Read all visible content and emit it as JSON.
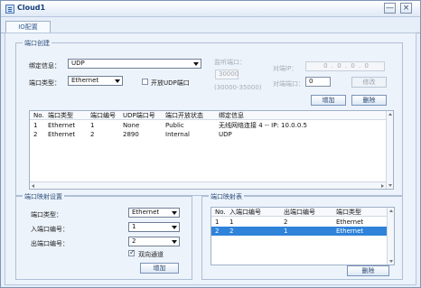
{
  "window": {
    "title": "Cloud1",
    "controls": {
      "minimize": "—",
      "close": "×"
    }
  },
  "tabs": [
    {
      "label": "IO配置",
      "selected": true
    }
  ],
  "port_creation": {
    "title": "端口创建",
    "binding_info_label": "绑定信息：",
    "binding_info_value": "UDP",
    "port_type_label": "端口类型：",
    "port_type_value": "Ethernet",
    "open_udp_label": "开放UDP端口",
    "open_udp_checked": false,
    "listen_port_label": "监听端口：",
    "listen_port_value": "30000",
    "listen_range": "(30000-35000)",
    "peer_ip_label": "对端IP：",
    "peer_ip_value": "0 . 0 . 0 . 0",
    "peer_port_label": "对端端口：",
    "peer_port_value": "0",
    "modify_button": "修改",
    "add_button": "增加",
    "delete_button": "删除",
    "table": {
      "headers": [
        "No.",
        "端口类型",
        "端口编号",
        "UDP端口号",
        "端口开放状态",
        "绑定信息"
      ],
      "rows": [
        [
          "1",
          "Ethernet",
          "1",
          "None",
          "Public",
          "无线网络连接 4 -- IP: 10.0.0.5"
        ],
        [
          "2",
          "Ethernet",
          "2",
          "2890",
          "Internal",
          "UDP"
        ]
      ]
    }
  },
  "port_mapping_settings": {
    "title": "端口映射设置",
    "port_type_label": "端口类型：",
    "port_type_value": "Ethernet",
    "in_port_label": "入端口编号：",
    "in_port_value": "1",
    "out_port_label": "出端口编号：",
    "out_port_value": "2",
    "bidirectional_label": "双向通道",
    "bidirectional_checked": true,
    "add_button": "增加"
  },
  "port_mapping_table": {
    "title": "端口映射表",
    "headers": [
      "No.",
      "入端口编号",
      "出端口编号",
      "端口类型"
    ],
    "rows": [
      [
        "1",
        "1",
        "2",
        "Ethernet"
      ],
      [
        "2",
        "2",
        "1",
        "Ethernet"
      ]
    ],
    "selected_row": 2,
    "delete_button": "删除"
  }
}
